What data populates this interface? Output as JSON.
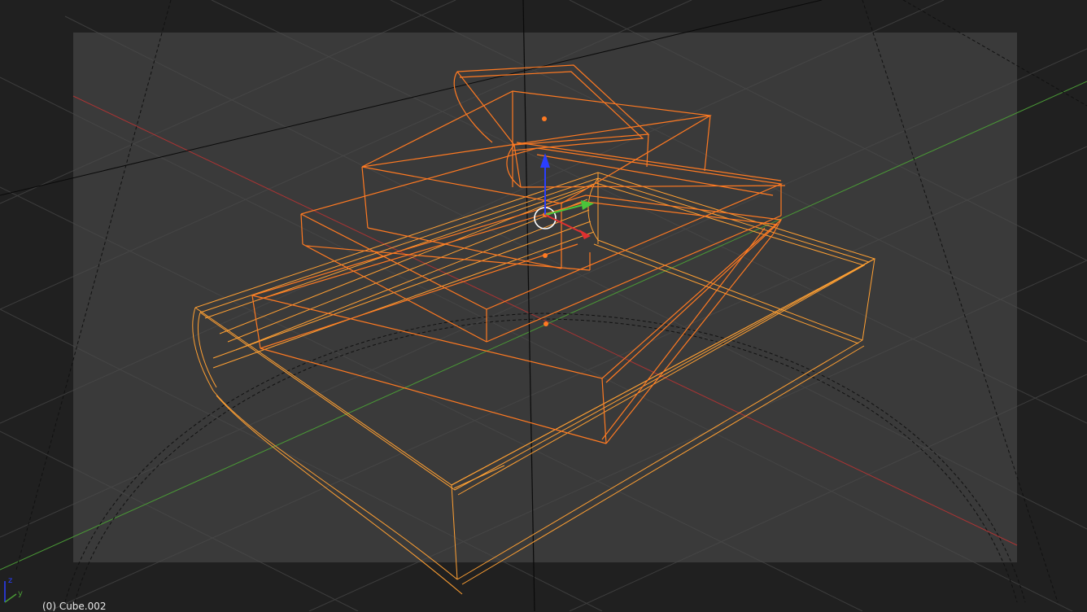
{
  "viewport": {
    "object_label": "(0) Cube.002",
    "background_color": "#202020",
    "camera_frame_fill": "#3a3a3a",
    "selection_color": "#ff7a22",
    "active_object_color": "#ffa033",
    "axis_x_color": "#c83232",
    "axis_y_color": "#4a9a36",
    "axis_z_color": "#2a3eff"
  },
  "gizmo": {
    "axes": [
      "x",
      "y",
      "z"
    ],
    "arrow_icons": [
      "x-arrow-icon",
      "y-arrow-icon",
      "z-arrow-icon"
    ]
  },
  "orientation_widget": {
    "axes": [
      "y",
      "z"
    ]
  }
}
